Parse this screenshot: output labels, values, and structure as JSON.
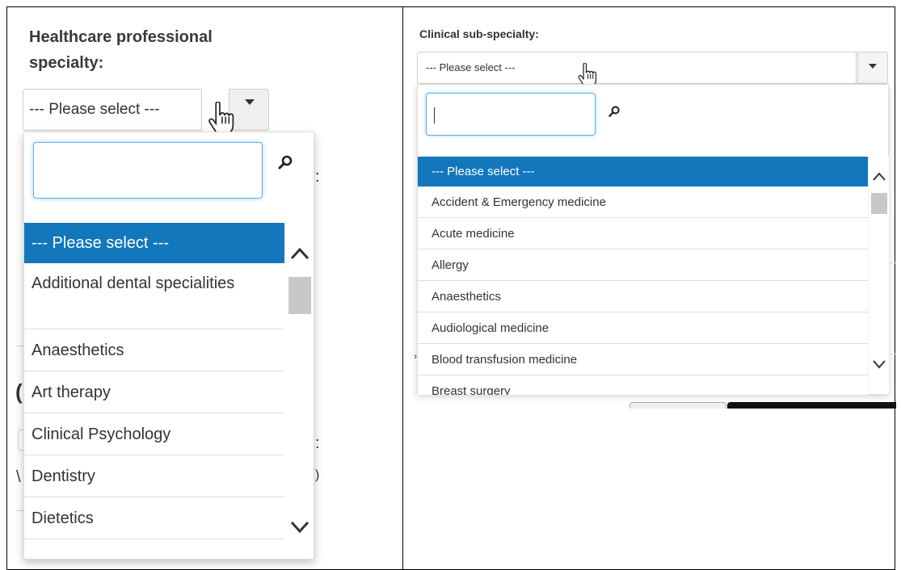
{
  "left": {
    "label": "Healthcare professional specialty:",
    "selected_value": "--- Please select ---",
    "search_value": "",
    "options": [
      "--- Please select ---",
      "Additional dental specialities",
      "Anaesthetics",
      "Art therapy",
      "Clinical Psychology",
      "Dentistry",
      "Dietetics"
    ],
    "highlighted_index": 0
  },
  "right": {
    "label": "Clinical sub-specialty:",
    "selected_value": "--- Please select ---",
    "search_value": "",
    "options": [
      "--- Please select ---",
      "Accident & Emergency medicine",
      "Acute medicine",
      "Allergy",
      "Anaesthetics",
      "Audiological medicine",
      "Blood transfusion medicine",
      "Breast surgery"
    ],
    "highlighted_index": 0
  },
  "colors": {
    "highlight": "#1277bb",
    "focus_border": "#66afe9",
    "scroll_thumb": "#c8c8c8"
  },
  "icons": [
    "search-icon",
    "chevron-up-icon",
    "chevron-down-icon",
    "caret-down-icon",
    "hand-pointer-icon"
  ]
}
